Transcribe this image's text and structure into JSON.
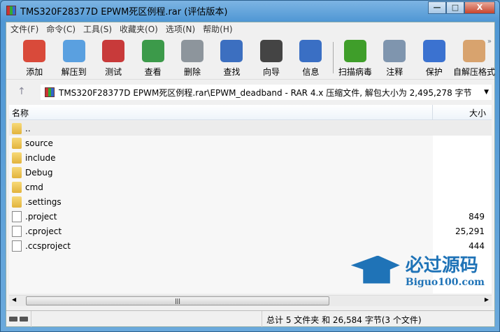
{
  "window": {
    "title": "TMS320F28377D EPWM死区例程.rar (评估版本)",
    "min": "—",
    "max": "□",
    "close": "X"
  },
  "menu": [
    "文件(F)",
    "命令(C)",
    "工具(S)",
    "收藏夹(O)",
    "选项(N)",
    "帮助(H)"
  ],
  "toolbar": [
    {
      "label": "添加",
      "color": "#d94a3a"
    },
    {
      "label": "解压到",
      "color": "#5aa0e0"
    },
    {
      "label": "测试",
      "color": "#c83a3a"
    },
    {
      "label": "查看",
      "color": "#3c9a4a"
    },
    {
      "label": "删除",
      "color": "#8d959c"
    },
    {
      "label": "查找",
      "color": "#3c6fc0"
    },
    {
      "label": "向导",
      "color": "#444"
    },
    {
      "label": "信息",
      "color": "#3a6fc4"
    },
    {
      "label": "扫描病毒",
      "color": "#3f9e2a"
    },
    {
      "label": "注释",
      "color": "#7f95ae"
    },
    {
      "label": "保护",
      "color": "#3b72d0"
    },
    {
      "label": "自解压格式",
      "color": "#d8a36e"
    }
  ],
  "address": {
    "path": "TMS320F28377D EPWM死区例程.rar\\EPWM_deadband - RAR 4.x 压缩文件, 解包大小为 2,495,278 字节"
  },
  "columns": {
    "name": "名称",
    "size": "大小"
  },
  "files": [
    {
      "name": "..",
      "size": "",
      "type": "folder"
    },
    {
      "name": "source",
      "size": "",
      "type": "folder"
    },
    {
      "name": "include",
      "size": "",
      "type": "folder"
    },
    {
      "name": "Debug",
      "size": "",
      "type": "folder"
    },
    {
      "name": "cmd",
      "size": "",
      "type": "folder"
    },
    {
      "name": ".settings",
      "size": "",
      "type": "folder"
    },
    {
      "name": ".project",
      "size": "849",
      "type": "file"
    },
    {
      "name": ".cproject",
      "size": "25,291",
      "type": "file"
    },
    {
      "name": ".ccsproject",
      "size": "444",
      "type": "file"
    }
  ],
  "watermark": {
    "cn": "必过源码",
    "en": "Biguo100.com"
  },
  "status": "总计 5 文件夹 和 26,584 字节(3 个文件)"
}
